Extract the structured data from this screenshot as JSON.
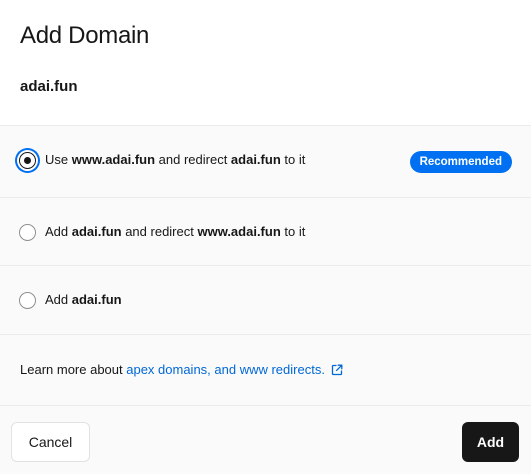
{
  "dialog": {
    "title": "Add Domain",
    "domain": "adai.fun"
  },
  "options": [
    {
      "selected": true,
      "parts": [
        "Use ",
        "www.adai.fun",
        " and redirect ",
        "adai.fun",
        " to it"
      ],
      "badge": "Recommended"
    },
    {
      "selected": false,
      "parts": [
        "Add ",
        "adai.fun",
        " and redirect ",
        "www.adai.fun",
        " to it"
      ]
    },
    {
      "selected": false,
      "parts": [
        "Add ",
        "adai.fun"
      ]
    }
  ],
  "learn_more": {
    "prefix": "Learn more about ",
    "link": "apex domains, and www redirects.",
    "link_icon": "external-link-icon"
  },
  "footer": {
    "cancel_label": "Cancel",
    "add_label": "Add"
  },
  "colors": {
    "accent": "#0070f3",
    "link": "#0068d6",
    "primary_button": "#171717"
  }
}
